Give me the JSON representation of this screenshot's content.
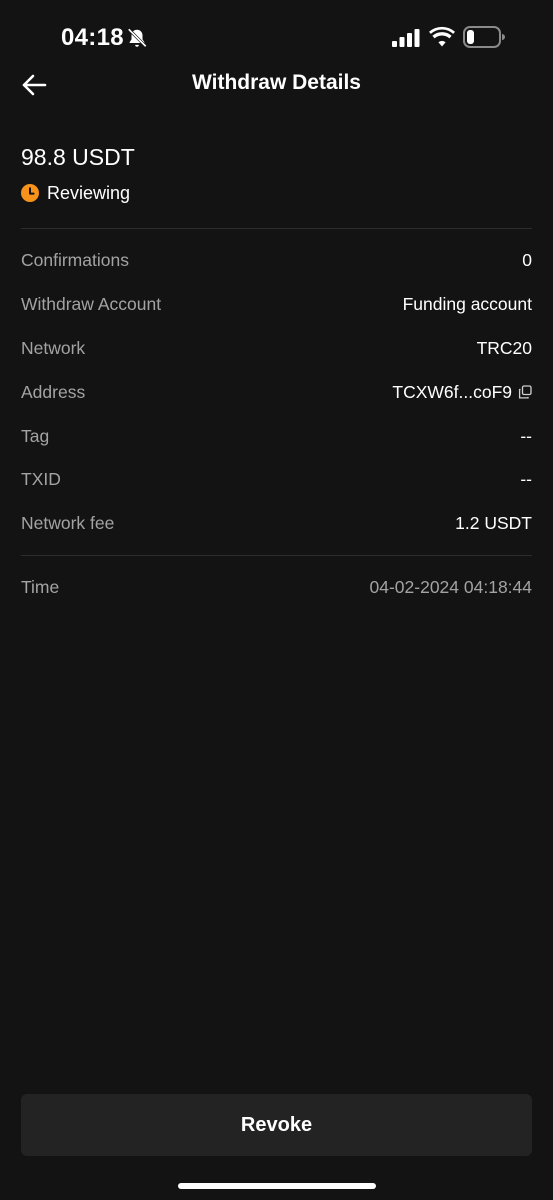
{
  "status_bar": {
    "time": "04:18",
    "icons": [
      "bell-off-icon",
      "signal-icon",
      "wifi-icon",
      "battery-icon"
    ]
  },
  "header": {
    "title": "Withdraw Details",
    "back_icon": "arrow-left-icon"
  },
  "summary": {
    "amount": "98.8 USDT",
    "status": "Reviewing",
    "status_icon": "clock-icon",
    "status_color": "#f7931a"
  },
  "details": [
    {
      "label": "Confirmations",
      "value": "0"
    },
    {
      "label": "Withdraw Account",
      "value": "Funding account"
    },
    {
      "label": "Network",
      "value": "TRC20"
    },
    {
      "label": "Address",
      "value": "TCXW6f...coF9",
      "copy_icon": "copy-icon"
    },
    {
      "label": "Tag",
      "value": "--"
    },
    {
      "label": "TXID",
      "value": "--"
    },
    {
      "label": "Network fee",
      "value": "1.2 USDT"
    }
  ],
  "time": {
    "label": "Time",
    "value": "04-02-2024 04:18:44"
  },
  "actions": {
    "revoke_label": "Revoke"
  },
  "colors": {
    "background": "#131313",
    "button_bg": "#232323",
    "muted_text": "#a3a3a3",
    "accent": "#f7931a"
  }
}
